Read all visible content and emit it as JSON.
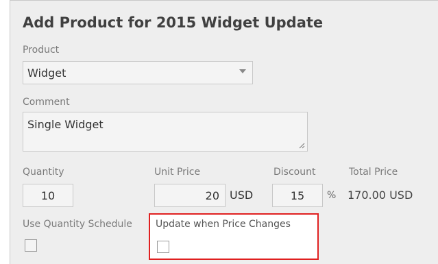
{
  "form": {
    "title": "Add Product for 2015 Widget Update",
    "product": {
      "label": "Product",
      "value": "Widget"
    },
    "comment": {
      "label": "Comment",
      "value": "Single Widget"
    },
    "quantity": {
      "label": "Quantity",
      "value": "10"
    },
    "unit_price": {
      "label": "Unit Price",
      "value": "20",
      "currency": "USD"
    },
    "discount": {
      "label": "Discount",
      "value": "15",
      "unit": "%"
    },
    "total_price": {
      "label": "Total Price",
      "value": "170.00 USD"
    },
    "use_quantity_schedule": {
      "label": "Use Quantity Schedule",
      "checked": false
    },
    "update_when_price_changes": {
      "label": "Update when Price Changes",
      "checked": false
    }
  },
  "colors": {
    "highlight": "#e02020",
    "panel_bg": "#eeeeee"
  }
}
